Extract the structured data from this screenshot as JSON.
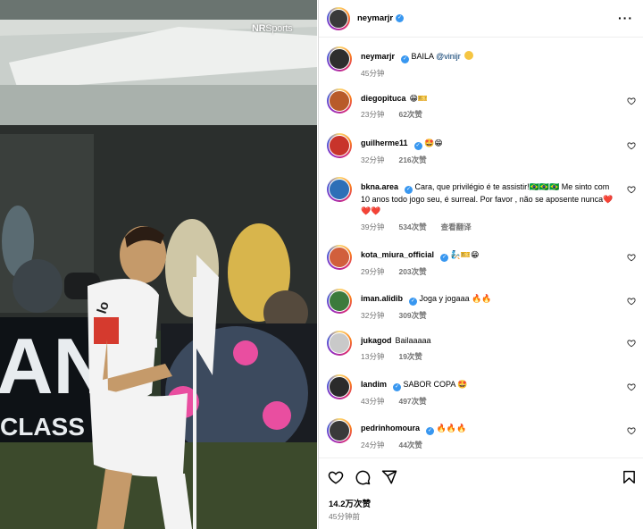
{
  "media": {
    "watermark_bold": "NR",
    "watermark_rest": "Sports",
    "jersey_text": "lo",
    "board_text": "ANT",
    "board_sub": "CLASS"
  },
  "header": {
    "username": "neymarjr",
    "verified": true,
    "more_icon": "more-horizontal-icon"
  },
  "caption": {
    "username": "neymarjr",
    "text": "BAILA",
    "mention": "@vinijr",
    "time": "45分钟"
  },
  "comments": [
    {
      "username": "diegopituca",
      "text": "😁🎫",
      "time": "23分钟",
      "likes": "62次赞",
      "reply": "",
      "translate": ""
    },
    {
      "username": "guilherme11",
      "verified": true,
      "text": "🤩😁",
      "time": "32分钟",
      "likes": "216次赞",
      "reply": "",
      "translate": ""
    },
    {
      "username": "bkna.area",
      "verified": true,
      "text": "Cara, que privilégio é te assistir!🇧🇷🇧🇷🇧🇷 Me sinto com 10 anos todo jogo seu, é surreal. Por favor , não se aposente nunca❤️❤️❤️",
      "time": "39分钟",
      "likes": "534次赞",
      "reply": "",
      "translate": "查看翻译"
    },
    {
      "username": "kota_miura_official",
      "verified": true,
      "text": "🧞🎫😁",
      "time": "29分钟",
      "likes": "203次赞",
      "reply": "",
      "translate": ""
    },
    {
      "username": "iman.alidib",
      "verified": true,
      "text": "Joga y jogaaa 🔥🔥",
      "time": "32分钟",
      "likes": "309次赞",
      "reply": "",
      "translate": ""
    },
    {
      "username": "jukagod",
      "text": "Bailaaaaa",
      "time": "13分钟",
      "likes": "19次赞",
      "reply": "",
      "translate": ""
    },
    {
      "username": "landim",
      "verified": true,
      "text": "SABOR COPA 🤩",
      "time": "43分钟",
      "likes": "497次赞",
      "reply": "",
      "translate": ""
    },
    {
      "username": "pedrinhomoura",
      "verified": true,
      "text": "🔥🔥🔥",
      "time": "24分钟",
      "likes": "44次赞",
      "reply": "",
      "translate": ""
    }
  ],
  "footer": {
    "like_icon": "heart-icon",
    "comment_icon": "comment-icon",
    "share_icon": "share-icon",
    "save_icon": "bookmark-icon",
    "likes_total": "14.2万次赞",
    "post_time": "45分钟前"
  },
  "colors": {
    "verified": "#3897f0",
    "mention": "#00376b",
    "meta": "#737373"
  }
}
